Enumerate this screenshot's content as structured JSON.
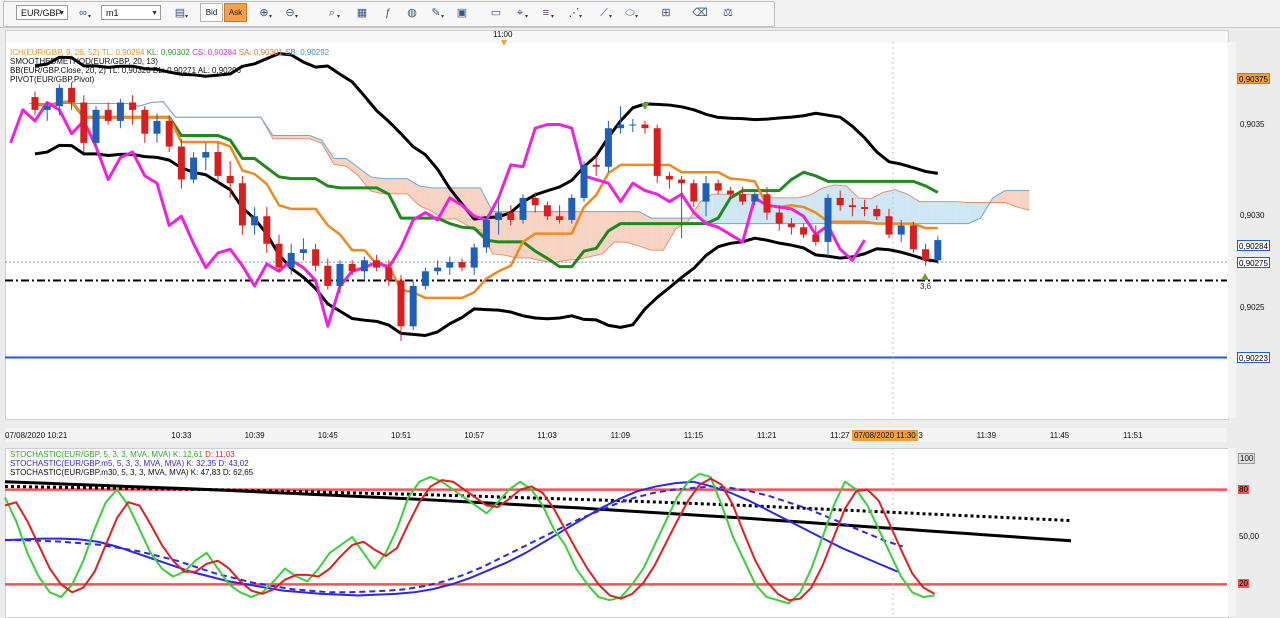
{
  "toolbar": {
    "symbol": "EUR/GBP",
    "timeframe": "m1",
    "bid_label": "Bid",
    "ask_label": "Ask",
    "tools": [
      {
        "name": "chart-type-icon",
        "glyph": "▤",
        "dropdown": true
      },
      {
        "name": "zoom-in-icon",
        "glyph": "⊕",
        "dropdown": true
      },
      {
        "name": "zoom-out-icon",
        "glyph": "⊖",
        "dropdown": true
      },
      {
        "name": "zoom-fit-icon",
        "glyph": "⌕",
        "dropdown": true
      },
      {
        "name": "template-icon",
        "glyph": "▦",
        "dropdown": false
      },
      {
        "name": "indicators-icon",
        "glyph": "ƒ",
        "dropdown": false
      },
      {
        "name": "globe-icon",
        "glyph": "◍",
        "dropdown": false
      },
      {
        "name": "pencil-icon",
        "glyph": "✎",
        "dropdown": true
      },
      {
        "name": "screenshot-icon",
        "glyph": "▣",
        "dropdown": false
      },
      {
        "name": "window-icon",
        "glyph": "▭",
        "dropdown": false
      },
      {
        "name": "crosshair-icon",
        "glyph": "⌖",
        "dropdown": true
      },
      {
        "name": "lines-icon",
        "glyph": "≡",
        "dropdown": true
      },
      {
        "name": "fib-icon",
        "glyph": "⋰",
        "dropdown": true
      },
      {
        "name": "channel-icon",
        "glyph": "⟋",
        "dropdown": true
      },
      {
        "name": "ellipse-icon",
        "glyph": "⬭",
        "dropdown": true
      },
      {
        "name": "grid-icon",
        "glyph": "⊞",
        "dropdown": false
      },
      {
        "name": "eraser-icon",
        "glyph": "⌫",
        "dropdown": false
      },
      {
        "name": "scale-icon",
        "glyph": "⚖",
        "dropdown": false
      }
    ]
  },
  "time_marker": "11:00",
  "price_legend": [
    {
      "text": "ICH(EUR/GBP, 9, 26, 52)",
      "color": "#e8941e"
    },
    {
      "text": "TL: 0,90294",
      "color": "#e8941e"
    },
    {
      "text": "KL: 0,90302",
      "color": "#2a9a2a"
    },
    {
      "text": "CS: 0,90284",
      "color": "#e030e0"
    },
    {
      "text": "SA: 0,90301",
      "color": "#e8743e"
    },
    {
      "text": "SB: 0,90292",
      "color": "#4a8ac8"
    }
  ],
  "price_legend_lines": [
    "SMOOTHEDMETHOD(EUR/GBP, 20, 13)",
    "BB(EUR/GBP.Close, 20, 2)  TL: 0,90320  BL: 0,90271  AL: 0,90296",
    "PIVOT(EUR/GBP,Pivot)"
  ],
  "price_axis": {
    "min": 0.9019,
    "max": 0.90395,
    "ticks": [
      "0,9035",
      "0,9030",
      "0,9025"
    ],
    "tick_values": [
      0.9035,
      0.903,
      0.9025
    ],
    "boxes": [
      {
        "label": "0,90375",
        "value": 0.90375,
        "bg": "#f5a035",
        "fg": "#000"
      },
      {
        "label": "0,90284",
        "value": 0.90284,
        "bg": "#ffffff",
        "fg": "#000"
      },
      {
        "label": "0,90275",
        "value": 0.90275,
        "bg": "#ffffff",
        "fg": "#000"
      },
      {
        "label": "0,90223",
        "value": 0.90223,
        "bg": "#ffffff",
        "fg": "#000"
      }
    ]
  },
  "time_axis": {
    "labels": [
      "07/08/2020 10:21",
      "10:33",
      "10:39",
      "10:45",
      "10:51",
      "10:57",
      "11:03",
      "11:09",
      "11:15",
      "11:21",
      "11:27",
      "11:33",
      "11:39",
      "11:45",
      "11:51"
    ],
    "label_bars": [
      0,
      12,
      18,
      24,
      30,
      36,
      42,
      48,
      54,
      60,
      66,
      72,
      78,
      84,
      90
    ],
    "highlight": "07/08/2020 11:30"
  },
  "annotation": "3,6",
  "levels": {
    "pivot": 0.90265,
    "support_blue": 0.90223,
    "last_price": 0.90275
  },
  "candles": [
    [
      0.90365,
      0.90368,
      0.90355,
      0.90358
    ],
    [
      0.90358,
      0.90362,
      0.90352,
      0.9036
    ],
    [
      0.9036,
      0.90372,
      0.90355,
      0.9037
    ],
    [
      0.9037,
      0.90373,
      0.90358,
      0.90362
    ],
    [
      0.90362,
      0.90366,
      0.90335,
      0.9034
    ],
    [
      0.9034,
      0.9036,
      0.90338,
      0.90358
    ],
    [
      0.90358,
      0.90362,
      0.9035,
      0.90352
    ],
    [
      0.90352,
      0.90364,
      0.90348,
      0.90362
    ],
    [
      0.90362,
      0.90366,
      0.9035,
      0.90358
    ],
    [
      0.90358,
      0.9036,
      0.9034,
      0.90345
    ],
    [
      0.90345,
      0.90356,
      0.9034,
      0.90352
    ],
    [
      0.90352,
      0.90355,
      0.90335,
      0.90338
    ],
    [
      0.90338,
      0.90342,
      0.90315,
      0.9032
    ],
    [
      0.9032,
      0.90335,
      0.90318,
      0.90332
    ],
    [
      0.90332,
      0.9034,
      0.90325,
      0.90335
    ],
    [
      0.90335,
      0.9034,
      0.90318,
      0.90322
    ],
    [
      0.90322,
      0.9033,
      0.9031,
      0.90318
    ],
    [
      0.90318,
      0.90322,
      0.9029,
      0.90295
    ],
    [
      0.90295,
      0.90305,
      0.9029,
      0.903
    ],
    [
      0.903,
      0.90305,
      0.9028,
      0.90285
    ],
    [
      0.90285,
      0.9029,
      0.9027,
      0.90272
    ],
    [
      0.90272,
      0.90285,
      0.90268,
      0.9028
    ],
    [
      0.9028,
      0.90288,
      0.90276,
      0.90282
    ],
    [
      0.90282,
      0.90285,
      0.9027,
      0.90273
    ],
    [
      0.90273,
      0.90277,
      0.9026,
      0.90262
    ],
    [
      0.90262,
      0.90276,
      0.90258,
      0.90274
    ],
    [
      0.90274,
      0.90276,
      0.90268,
      0.9027
    ],
    [
      0.9027,
      0.90278,
      0.90265,
      0.90276
    ],
    [
      0.90276,
      0.90279,
      0.9027,
      0.90272
    ],
    [
      0.90272,
      0.90276,
      0.90262,
      0.90265
    ],
    [
      0.90265,
      0.90268,
      0.90232,
      0.9024
    ],
    [
      0.9024,
      0.90265,
      0.90238,
      0.90262
    ],
    [
      0.90262,
      0.90272,
      0.9026,
      0.9027
    ],
    [
      0.9027,
      0.90276,
      0.90268,
      0.90272
    ],
    [
      0.90272,
      0.90278,
      0.90268,
      0.90275
    ],
    [
      0.90275,
      0.90277,
      0.9027,
      0.90272
    ],
    [
      0.90272,
      0.90285,
      0.90268,
      0.90283
    ],
    [
      0.90283,
      0.903,
      0.9028,
      0.90298
    ],
    [
      0.90298,
      0.90308,
      0.9029,
      0.90302
    ],
    [
      0.90302,
      0.90306,
      0.90295,
      0.90298
    ],
    [
      0.90298,
      0.90312,
      0.90296,
      0.9031
    ],
    [
      0.9031,
      0.90313,
      0.90302,
      0.90306
    ],
    [
      0.90306,
      0.90308,
      0.90298,
      0.903
    ],
    [
      0.903,
      0.90306,
      0.90296,
      0.90298
    ],
    [
      0.90298,
      0.90312,
      0.90296,
      0.9031
    ],
    [
      0.9031,
      0.9033,
      0.90308,
      0.90328
    ],
    [
      0.90328,
      0.90333,
      0.90322,
      0.90327
    ],
    [
      0.90327,
      0.90352,
      0.90324,
      0.90348
    ],
    [
      0.90348,
      0.9036,
      0.90345,
      0.9035
    ],
    [
      0.9035,
      0.90353,
      0.90346,
      0.9035
    ],
    [
      0.9035,
      0.90352,
      0.90345,
      0.90348
    ],
    [
      0.90348,
      0.9035,
      0.90318,
      0.90322
    ],
    [
      0.90322,
      0.90324,
      0.90315,
      0.9032
    ],
    [
      0.9032,
      0.90322,
      0.90288,
      0.90318
    ],
    [
      0.90318,
      0.9032,
      0.90305,
      0.90308
    ],
    [
      0.90308,
      0.90322,
      0.903,
      0.90318
    ],
    [
      0.90318,
      0.9032,
      0.90312,
      0.90314
    ],
    [
      0.90314,
      0.90316,
      0.9031,
      0.90312
    ],
    [
      0.90312,
      0.90316,
      0.90306,
      0.90308
    ],
    [
      0.90308,
      0.90313,
      0.90306,
      0.90312
    ],
    [
      0.90312,
      0.90316,
      0.90298,
      0.90302
    ],
    [
      0.90302,
      0.90306,
      0.90292,
      0.90296
    ],
    [
      0.90296,
      0.90299,
      0.9029,
      0.90294
    ],
    [
      0.90294,
      0.90296,
      0.90288,
      0.9029
    ],
    [
      0.9029,
      0.90295,
      0.90284,
      0.90286
    ],
    [
      0.90286,
      0.90312,
      0.90278,
      0.9031
    ],
    [
      0.9031,
      0.90314,
      0.90303,
      0.90306
    ],
    [
      0.90306,
      0.9031,
      0.903,
      0.90305
    ],
    [
      0.90305,
      0.90309,
      0.903,
      0.90304
    ],
    [
      0.90304,
      0.90306,
      0.90298,
      0.903
    ],
    [
      0.903,
      0.90304,
      0.90288,
      0.9029
    ],
    [
      0.9029,
      0.90298,
      0.90286,
      0.90295
    ],
    [
      0.90295,
      0.90297,
      0.9028,
      0.90282
    ],
    [
      0.90282,
      0.90285,
      0.90273,
      0.90276
    ],
    [
      0.90276,
      0.90289,
      0.90274,
      0.90287
    ]
  ],
  "lower_legend": [
    {
      "text": "STOCHASTIC(EUR/GBP, 5, 3, 3, MVA, MVA)",
      "color": "#3ad03a",
      "k": "K: 12,61",
      "d": "D: 11,03"
    },
    {
      "text": "STOCHASTIC(EUR/GBP.m5, 5, 3, 3, MVA, MVA)",
      "color": "#2a2ae0",
      "k": "K: 32,35",
      "d": "D: 43,02"
    },
    {
      "text": "STOCHASTIC(EUR/GBP.m30, 5, 3, 3, MVA, MVA)",
      "color": "#111111",
      "k": "K: 47,83",
      "d": "D: 62,65"
    }
  ],
  "stoch_axis": {
    "labels": [
      "100",
      "80",
      "50,00",
      "20"
    ],
    "values": [
      100,
      80,
      50,
      20
    ]
  },
  "stochastic": {
    "green_k": [
      75,
      60,
      40,
      25,
      15,
      12,
      20,
      35,
      55,
      72,
      80,
      70,
      55,
      40,
      30,
      25,
      28,
      35,
      40,
      30,
      20,
      15,
      12,
      15,
      22,
      30,
      25,
      22,
      30,
      40,
      45,
      50,
      40,
      30,
      40,
      55,
      75,
      85,
      88,
      85,
      80,
      75,
      70,
      65,
      72,
      80,
      85,
      80,
      70,
      55,
      45,
      30,
      20,
      12,
      10,
      12,
      20,
      30,
      45,
      60,
      75,
      85,
      90,
      88,
      70,
      50,
      35,
      20,
      12,
      10,
      8,
      15,
      30,
      50,
      70,
      85,
      80,
      70,
      55,
      40,
      25,
      15,
      12,
      13
    ],
    "red_d": [
      70,
      72,
      60,
      45,
      30,
      20,
      15,
      18,
      28,
      45,
      62,
      72,
      70,
      58,
      45,
      35,
      28,
      28,
      33,
      35,
      30,
      22,
      16,
      14,
      17,
      23,
      26,
      26,
      25,
      30,
      38,
      45,
      47,
      42,
      38,
      43,
      58,
      72,
      82,
      86,
      85,
      80,
      75,
      70,
      69,
      74,
      80,
      82,
      78,
      68,
      55,
      42,
      30,
      20,
      13,
      11,
      14,
      21,
      32,
      46,
      60,
      73,
      83,
      87,
      83,
      70,
      52,
      35,
      22,
      14,
      10,
      11,
      18,
      32,
      50,
      68,
      79,
      80,
      73,
      58,
      42,
      27,
      18,
      14
    ],
    "blue_k": [
      48,
      48.5,
      49,
      49,
      48.5,
      47,
      44,
      40,
      36,
      32,
      28,
      25,
      22,
      20,
      18,
      16,
      15,
      14,
      13.5,
      13,
      13.5,
      14,
      15,
      17,
      20,
      24,
      29,
      34,
      40,
      47,
      54,
      61,
      68,
      74,
      79,
      82,
      84,
      85,
      82,
      78,
      73,
      67,
      61,
      55,
      49,
      43,
      38,
      33,
      28
    ],
    "blue_d": [
      48,
      48,
      47.5,
      47,
      46,
      45,
      43,
      41,
      38,
      35,
      31,
      27,
      24,
      21,
      19,
      17,
      16,
      15,
      15,
      15.5,
      16,
      17,
      19,
      22,
      26,
      31,
      37,
      43,
      49,
      55,
      61,
      66,
      71,
      75,
      78,
      80,
      81,
      82,
      81,
      79,
      76,
      72,
      68,
      63,
      58,
      53,
      48,
      44
    ],
    "black_k": [
      85,
      84.5,
      84,
      83.5,
      83,
      82.5,
      82,
      81.5,
      81,
      80.5,
      80,
      79.4,
      78.8,
      78.2,
      77.6,
      77,
      76.4,
      75.8,
      75.2,
      74.6,
      74,
      73.3,
      72.6,
      71.9,
      71.2,
      70.5,
      69.8,
      69.1,
      68.4,
      67.6,
      66.8,
      66,
      65.2,
      64.4,
      63.6,
      62.8,
      62,
      61.1,
      60.2,
      59.3,
      58.4,
      57.5,
      56.6,
      55.7,
      54.8,
      53.9,
      53,
      52.1,
      51.2,
      50.3,
      49.4,
      48.5,
      47.6
    ],
    "black_d": [
      82,
      81.8,
      81.6,
      81.4,
      81.2,
      81,
      80.8,
      80.6,
      80.4,
      80.2,
      80,
      79.7,
      79.4,
      79.1,
      78.8,
      78.5,
      78.2,
      77.9,
      77.6,
      77.3,
      77,
      76.6,
      76.2,
      75.8,
      75.4,
      75,
      74.6,
      74.2,
      73.8,
      73.4,
      73,
      72.5,
      72,
      71.5,
      71,
      70.5,
      70,
      69.4,
      68.8,
      68.2,
      67.6,
      67,
      66.4,
      65.8,
      65.2,
      64.6,
      64,
      63.4,
      62.8,
      62.2,
      61.6,
      61,
      60.4
    ]
  }
}
